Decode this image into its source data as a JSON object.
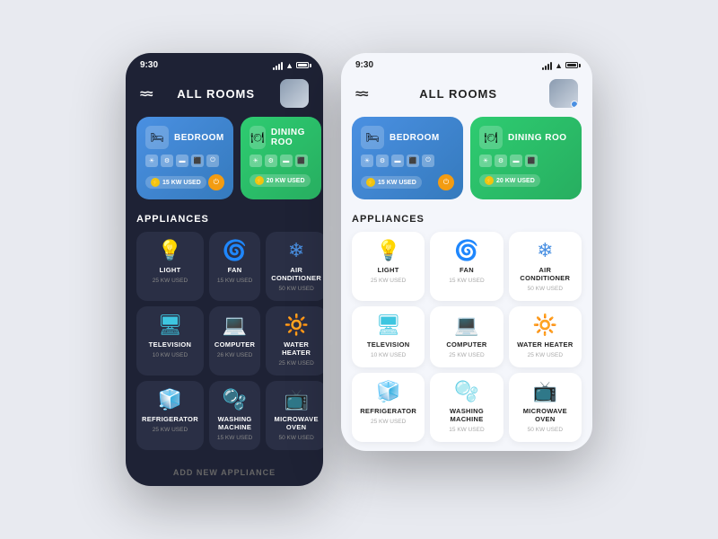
{
  "background": "#e8eaf0",
  "dark_phone": {
    "status_bar": {
      "time": "9:30"
    },
    "header": {
      "logo": "≈≈",
      "title": "ALL ROOMS"
    },
    "rooms": [
      {
        "name": "BEDROOM",
        "icon": "🛏",
        "kw": "15 KW USED",
        "gradient": "bedroom"
      },
      {
        "name": "DINING ROO",
        "icon": "🍽",
        "kw": "20 KW USED",
        "gradient": "dining"
      }
    ],
    "appliances_title": "APPLIANCES",
    "appliances": [
      {
        "icon": "💡",
        "name": "LIGHT",
        "kw": "25 KW USED"
      },
      {
        "icon": "🌀",
        "name": "FAN",
        "kw": "15 KW USED"
      },
      {
        "icon": "❄",
        "name": "AIR CONDITIONER",
        "kw": "50 KW USED"
      },
      {
        "icon": "🖥",
        "name": "TELEVISION",
        "kw": "10 KW USED"
      },
      {
        "icon": "💻",
        "name": "COMPUTER",
        "kw": "26 KW USED"
      },
      {
        "icon": "🔆",
        "name": "WATER HEATER",
        "kw": "25 KW USED"
      },
      {
        "icon": "🧊",
        "name": "REFRIGERATOR",
        "kw": "25 KW USED"
      },
      {
        "icon": "🫧",
        "name": "WASHING MACHINE",
        "kw": "15 KW USED"
      },
      {
        "icon": "📺",
        "name": "MICROWAVE OVEN",
        "kw": "50 KW USED"
      }
    ],
    "add_btn": "ADD NEW APPLIANCE"
  },
  "light_phone": {
    "status_bar": {
      "time": "9:30"
    },
    "header": {
      "logo": "≈≈",
      "title": "ALL ROOMS"
    },
    "rooms": [
      {
        "name": "BEDROOM",
        "icon": "🛏",
        "kw": "15 KW USED",
        "gradient": "bedroom"
      },
      {
        "name": "DINING ROO",
        "icon": "🍽",
        "kw": "20 KW USED",
        "gradient": "dining"
      }
    ],
    "appliances_title": "APPLIANCES",
    "appliances": [
      {
        "icon": "💡",
        "name": "LIGHT",
        "kw": "25 KW USED"
      },
      {
        "icon": "🌀",
        "name": "FAN",
        "kw": "15 KW USED"
      },
      {
        "icon": "❄",
        "name": "AIR CONDITIONER",
        "kw": "50 KW USED"
      },
      {
        "icon": "🖥",
        "name": "TELEVISION",
        "kw": "10 KW USED"
      },
      {
        "icon": "💻",
        "name": "COMPUTER",
        "kw": "25 KW USED"
      },
      {
        "icon": "🔆",
        "name": "WATER HEATER",
        "kw": "25 KW USED"
      },
      {
        "icon": "🧊",
        "name": "REFRIGERATOR",
        "kw": "25 KW USED"
      },
      {
        "icon": "🫧",
        "name": "WASHING MACHINE",
        "kw": "15 KW USED"
      },
      {
        "icon": "📺",
        "name": "MICROWAVE OVEN",
        "kw": "50 KW USED"
      }
    ]
  }
}
